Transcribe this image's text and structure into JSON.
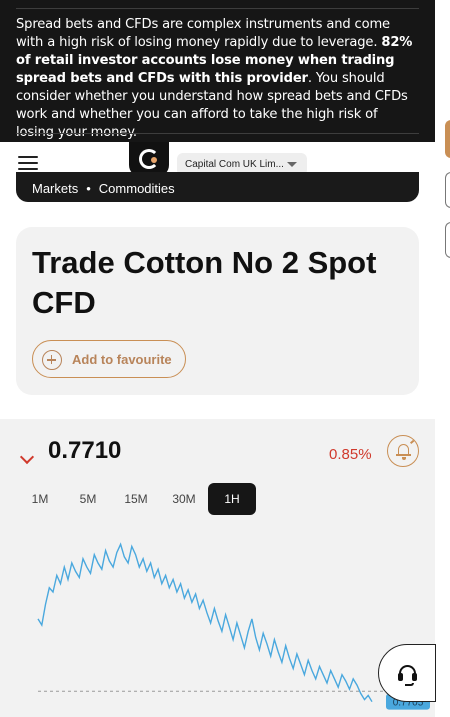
{
  "risk_warning": {
    "part1": "Spread bets and CFDs are complex instruments and come with a high risk of losing money rapidly due to leverage. ",
    "bold": "82% of retail investor accounts lose money when trading spread bets and CFDs with this provider",
    "part2": ". You should consider whether you understand how spread bets and CFDs work and whether you can afford to take the high risk of losing your money."
  },
  "header": {
    "menu_icon": "hamburger-icon",
    "logo_icon": "capital-com-logo",
    "entity_label": "Capital Com UK Lim..."
  },
  "breadcrumb": [
    "Markets",
    "Commodities"
  ],
  "breadcrumb_separator": "•",
  "instrument": {
    "title": "Trade Cotton No 2 Spot CFD",
    "favourite_label": "Add to favourite"
  },
  "quote": {
    "price": "0.7710",
    "change": "0.85%",
    "direction": "down",
    "down_color": "#d0392c",
    "accent_color": "#c98f55"
  },
  "timeframes": [
    {
      "label": "1M",
      "active": false
    },
    {
      "label": "5M",
      "active": false
    },
    {
      "label": "15M",
      "active": false
    },
    {
      "label": "30M",
      "active": false
    },
    {
      "label": "1H",
      "active": true
    }
  ],
  "chart_data": {
    "type": "line",
    "series_color": "#4aa8de",
    "values": [
      0.7745,
      0.7742,
      0.7752,
      0.776,
      0.7758,
      0.7766,
      0.7762,
      0.777,
      0.7764,
      0.7772,
      0.7768,
      0.7765,
      0.7774,
      0.777,
      0.7767,
      0.7776,
      0.7772,
      0.7769,
      0.7778,
      0.7773,
      0.777,
      0.7777,
      0.7781,
      0.7775,
      0.7772,
      0.778,
      0.7776,
      0.777,
      0.7774,
      0.7768,
      0.7772,
      0.7765,
      0.7769,
      0.7762,
      0.7766,
      0.776,
      0.7764,
      0.7758,
      0.7762,
      0.7755,
      0.7759,
      0.7753,
      0.7757,
      0.775,
      0.7754,
      0.7748,
      0.7743,
      0.775,
      0.7744,
      0.7739,
      0.7747,
      0.7741,
      0.7735,
      0.7743,
      0.7737,
      0.7731,
      0.7739,
      0.7745,
      0.7736,
      0.773,
      0.7738,
      0.7733,
      0.7727,
      0.7735,
      0.7729,
      0.7724,
      0.7732,
      0.7726,
      0.7721,
      0.7728,
      0.7723,
      0.7718,
      0.7725,
      0.772,
      0.7716,
      0.7722,
      0.7718,
      0.7714,
      0.772,
      0.7716,
      0.7712,
      0.7718,
      0.7715,
      0.7711,
      0.7716,
      0.7713,
      0.7709,
      0.7706,
      0.7708,
      0.7705
    ],
    "reference_value": 0.771,
    "last_label": "0.7705",
    "ylim": [
      0.77,
      0.7786
    ]
  },
  "support_icon": "headset-icon"
}
